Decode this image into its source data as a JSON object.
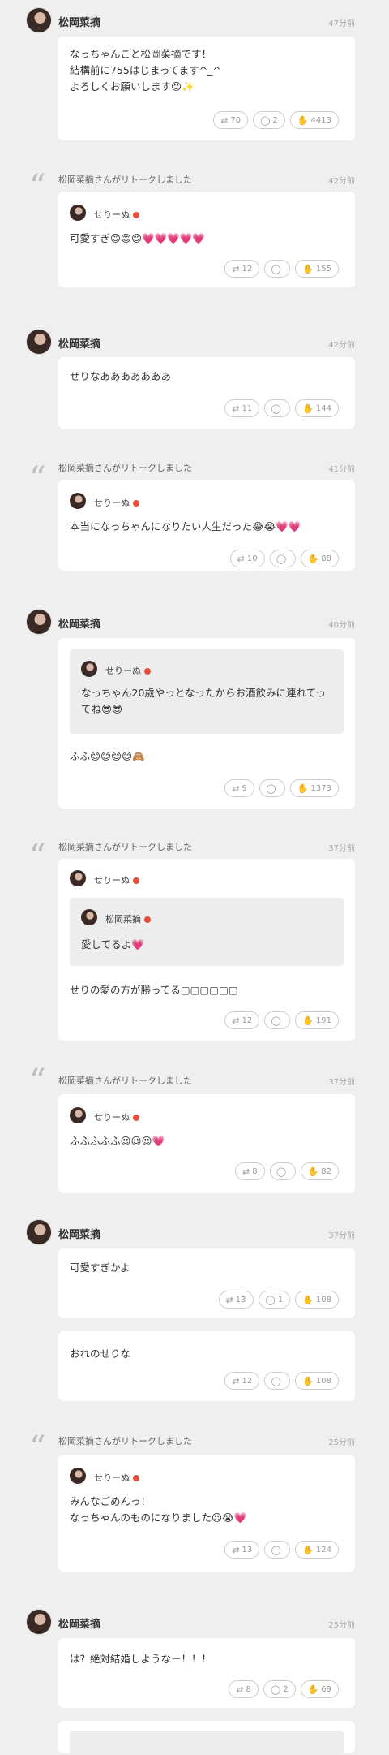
{
  "posts": [
    {
      "name": "松岡菜摘",
      "time": "47分前",
      "text": "なっちゃんこと松岡菜摘です！\n結構前に755はじまってます^_^\nよろしくお願いします☺✨",
      "rt": "70",
      "cm": "2",
      "lk": "4413"
    },
    {
      "label": "松岡菜摘さんがリトークしました",
      "time": "42分前",
      "quoted": "せりーぬ",
      "text": "可愛すぎ😊😊😊💗💗💗💗💗",
      "rt": "12",
      "cm": "",
      "lk": "155"
    },
    {
      "name": "松岡菜摘",
      "time": "42分前",
      "text": "せりなあああああああ",
      "rt": "11",
      "cm": "",
      "lk": "144"
    },
    {
      "label": "松岡菜摘さんがリトークしました",
      "time": "41分前",
      "quoted": "せりーぬ",
      "text": "本当になっちゃんになりたい人生だった😂😭💗💗",
      "rt": "10",
      "cm": "",
      "lk": "88"
    },
    {
      "name": "松岡菜摘",
      "time": "40分前",
      "quoted": "せりーぬ",
      "innerText": "なっちゃん20歳やっとなったからお酒飲みに連れてってね😎😎",
      "text": "ふふ😊😊😊😊🙈",
      "rt": "9",
      "cm": "",
      "lk": "1373"
    },
    {
      "label": "松岡菜摘さんがリトークしました",
      "time": "37分前",
      "quoted": "せりーぬ",
      "nestedName": "松岡菜摘",
      "nestedText": "愛してるよ💗",
      "text": "せりの愛の方が勝ってる▢▢▢▢▢▢",
      "rt": "12",
      "cm": "",
      "lk": "191"
    },
    {
      "label": "松岡菜摘さんがリトークしました",
      "time": "37分前",
      "quoted": "せりーぬ",
      "text": "ふふふふふ☺☺☺💗",
      "rt": "8",
      "cm": "",
      "lk": "82"
    },
    {
      "name": "松岡菜摘",
      "time": "37分前",
      "text": "可愛すぎかよ",
      "rt": "13",
      "cm": "1",
      "lk": "108"
    },
    {
      "text": "おれのせりな",
      "rt": "12",
      "cm": "",
      "lk": "108"
    },
    {
      "label": "松岡菜摘さんがリトークしました",
      "time": "25分前",
      "quoted": "せりーぬ",
      "text": "みんなごめんっ！\nなっちゃんのものになりました😍😭💗",
      "rt": "13",
      "cm": "",
      "lk": "124"
    },
    {
      "name": "松岡菜摘",
      "time": "25分前",
      "text": "は？絶対結婚しようなー！！！",
      "rt": "8",
      "cm": "2",
      "lk": "69"
    }
  ]
}
